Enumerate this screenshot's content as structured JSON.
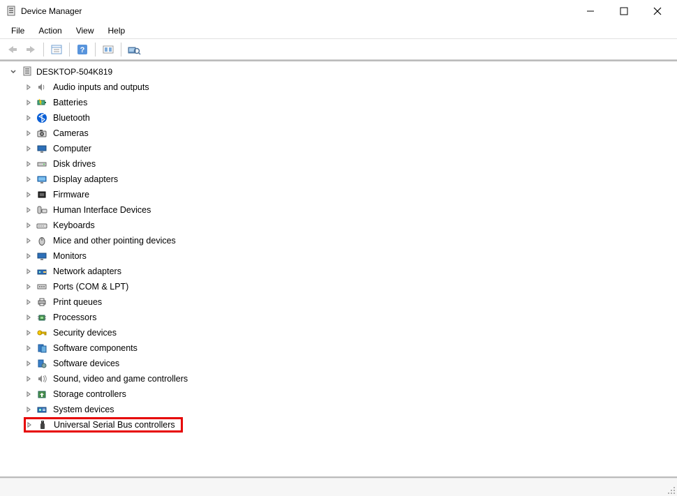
{
  "window": {
    "title": "Device Manager"
  },
  "menu": {
    "items": [
      "File",
      "Action",
      "View",
      "Help"
    ]
  },
  "toolbar": {
    "back": "Back",
    "forward": "Forward",
    "properties": "Properties",
    "help": "Help",
    "showhidden": "Show hidden",
    "scan": "Scan for hardware changes"
  },
  "tree": {
    "root": "DESKTOP-504K819",
    "nodes": [
      {
        "label": "Audio inputs and outputs",
        "icon": "speaker"
      },
      {
        "label": "Batteries",
        "icon": "battery"
      },
      {
        "label": "Bluetooth",
        "icon": "bluetooth"
      },
      {
        "label": "Cameras",
        "icon": "camera"
      },
      {
        "label": "Computer",
        "icon": "monitor"
      },
      {
        "label": "Disk drives",
        "icon": "disk"
      },
      {
        "label": "Display adapters",
        "icon": "display"
      },
      {
        "label": "Firmware",
        "icon": "firmware"
      },
      {
        "label": "Human Interface Devices",
        "icon": "hid"
      },
      {
        "label": "Keyboards",
        "icon": "keyboard"
      },
      {
        "label": "Mice and other pointing devices",
        "icon": "mouse"
      },
      {
        "label": "Monitors",
        "icon": "monitor2"
      },
      {
        "label": "Network adapters",
        "icon": "network"
      },
      {
        "label": "Ports (COM & LPT)",
        "icon": "port"
      },
      {
        "label": "Print queues",
        "icon": "printer"
      },
      {
        "label": "Processors",
        "icon": "cpu"
      },
      {
        "label": "Security devices",
        "icon": "key"
      },
      {
        "label": "Software components",
        "icon": "swcomp"
      },
      {
        "label": "Software devices",
        "icon": "swdev"
      },
      {
        "label": "Sound, video and game controllers",
        "icon": "sound"
      },
      {
        "label": "Storage controllers",
        "icon": "storage"
      },
      {
        "label": "System devices",
        "icon": "system"
      },
      {
        "label": "Universal Serial Bus controllers",
        "icon": "usb",
        "highlight": true
      }
    ]
  }
}
